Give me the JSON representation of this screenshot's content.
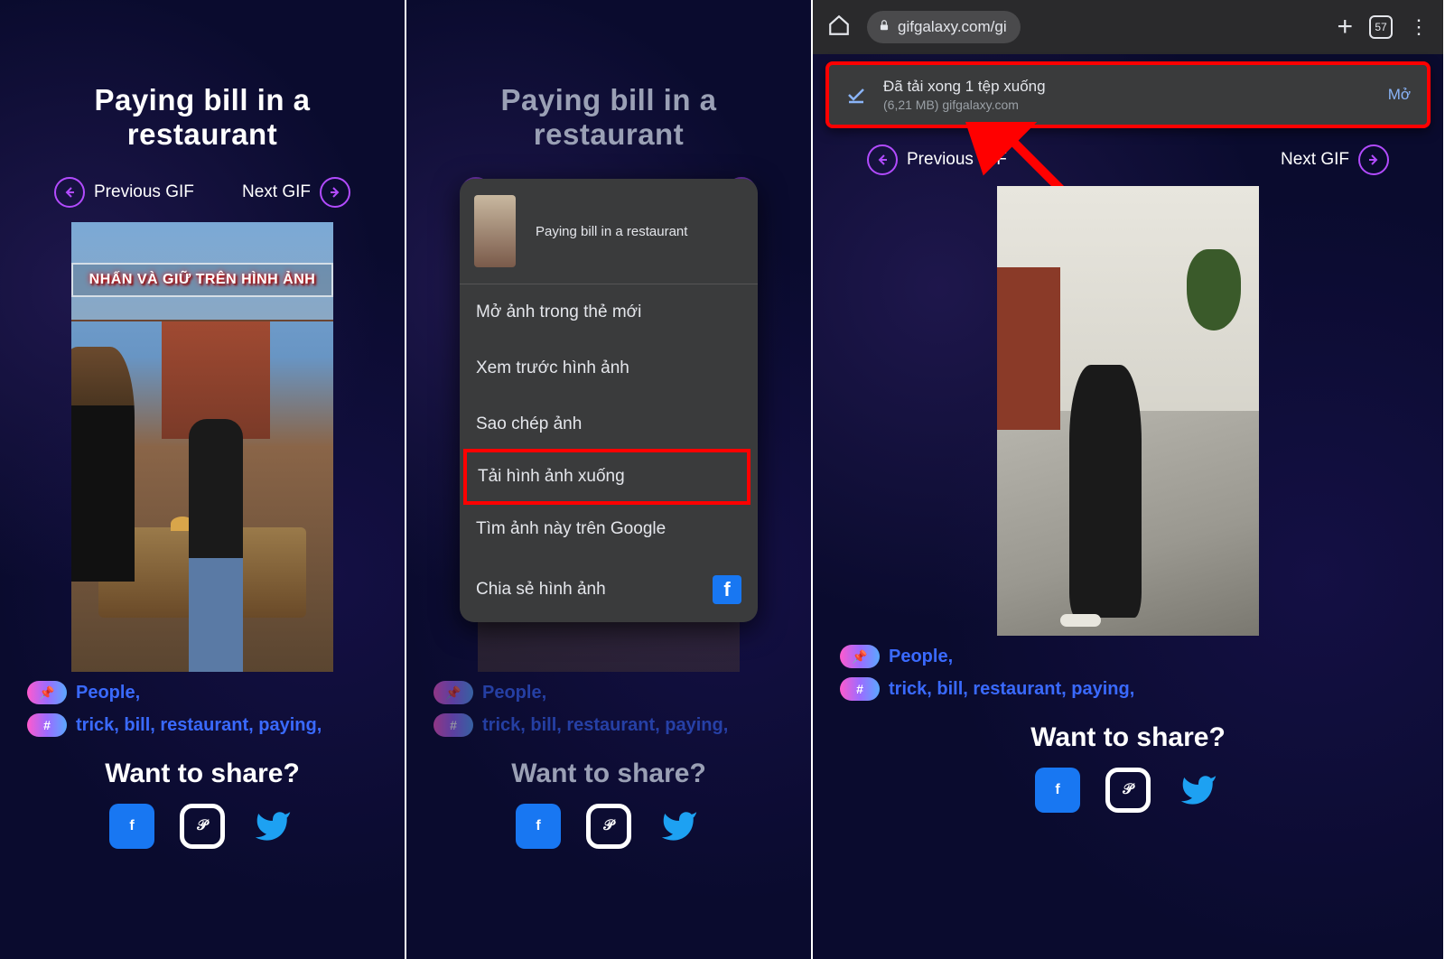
{
  "page": {
    "title": "Paying bill in a restaurant",
    "prev": "Previous GIF",
    "next": "Next GIF",
    "overlay": "NHẤN VÀ GIỮ TRÊN HÌNH ẢNH",
    "pin_tag": "People,",
    "hash_tags": "trick, bill, restaurant, paying,",
    "share_heading": "Want to share?"
  },
  "ctx": {
    "header": "Paying  bill in a restaurant",
    "items": [
      "Mở ảnh trong thẻ mới",
      "Xem trước hình ảnh",
      "Sao chép ảnh",
      "Tải hình ảnh xuống",
      "Tìm ảnh này trên Google",
      "Chia sẻ hình ảnh"
    ]
  },
  "chrome": {
    "url": "gifgalaxy.com/gi",
    "tab_count": "57"
  },
  "toast": {
    "line1": "Đã tải xong 1 tệp xuống",
    "line2": "(6,21 MB) gifgalaxy.com",
    "open": "Mở"
  }
}
